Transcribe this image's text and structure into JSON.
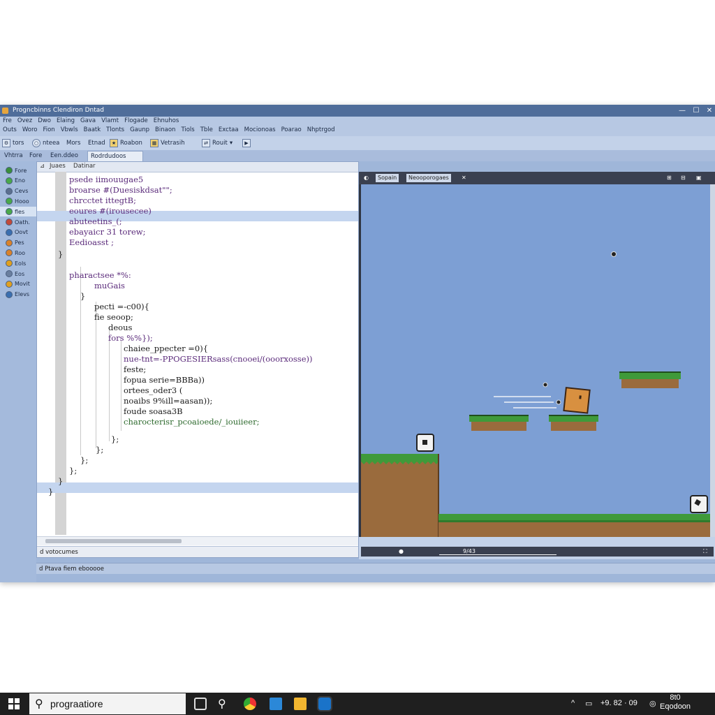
{
  "window": {
    "title": "Progncbinns Clendiron Dntad",
    "controls": [
      "—",
      "☐",
      "✕"
    ]
  },
  "menu": {
    "row1": [
      "Fre",
      "Ovez",
      "Dwo",
      "Elaing",
      "Gava",
      "Vlamt",
      "Flogade",
      "Ehnuhos"
    ],
    "row2": [
      "Outs",
      "Woro",
      "Fion",
      "Vbwls",
      "Baatk",
      "Tlonts",
      "Gaunp",
      "Binaon",
      "Tiols",
      "Tble",
      "Exctaa",
      "Mocionoas",
      "Poarao",
      "Nhptrgod"
    ]
  },
  "toolbar": {
    "items": [
      "tors",
      "nteea",
      "Mors",
      "Etnad",
      "Roabon",
      "Vetrasih",
      "Rouit"
    ],
    "dropdown_arrow": "▾"
  },
  "panel_tabs": [
    "Vhtrra",
    "Fore",
    "Een.ddeo",
    "Rodrdudoos"
  ],
  "sidebar": {
    "items": [
      {
        "label": "Fore",
        "color": "#3a8f3a"
      },
      {
        "label": "Eno",
        "color": "#4aa84a"
      },
      {
        "label": "Cevs",
        "color": "#5c6f8f"
      },
      {
        "label": "Hooo",
        "color": "#4aa84a"
      },
      {
        "label": "fles",
        "color": "#4aa84a"
      },
      {
        "label": "Oath.",
        "color": "#c24a3a"
      },
      {
        "label": "Oovt",
        "color": "#3a6fb0"
      },
      {
        "label": "Pes",
        "color": "#d9822b"
      },
      {
        "label": "Roo",
        "color": "#d9822b"
      },
      {
        "label": "Eols",
        "color": "#e0a020"
      },
      {
        "label": "Eos",
        "color": "#6a7f9f"
      },
      {
        "label": "Movit",
        "color": "#e0a020"
      },
      {
        "label": "Elevs",
        "color": "#3a6fb0"
      }
    ],
    "selected_index": 4
  },
  "editor": {
    "tabs": [
      "Juaes",
      "Datinar"
    ],
    "code_lines": [
      {
        "text": "psede iimouugae5",
        "color": "kw"
      },
      {
        "text": "broarse #(Duesiskdsat\"\";",
        "color": "kw"
      },
      {
        "text": "chrcctet ittegtB;",
        "color": "kw"
      },
      {
        "text": "eoures #(irousecee)",
        "color": "kw"
      },
      {
        "text": "abuteetins_(;",
        "color": "kw"
      },
      {
        "text": "ebayaicr 31 torew;",
        "color": "kw"
      },
      {
        "text": "Eedioasst ;",
        "color": "kw"
      },
      {
        "text": "}",
        "color": "kb"
      },
      {
        "text": "pharactsee *%:",
        "color": "kw"
      },
      {
        "text": "muGais",
        "color": "kw"
      },
      {
        "text": "}",
        "color": "kb"
      },
      {
        "text": "pecti =-c00){",
        "color": "kb"
      },
      {
        "text": "fie seoop;",
        "color": "kb"
      },
      {
        "text": "deous",
        "color": "kb"
      },
      {
        "text": "fors %%});",
        "color": "kw"
      },
      {
        "text": "chaiee_ppecter =0){",
        "color": "kb"
      },
      {
        "text": "nue-tnt=-PPOGESIERsass(cnooei/(ooorxosse))",
        "color": "kw"
      },
      {
        "text": "feste;",
        "color": "kb"
      },
      {
        "text": "fopua serie=BBBa))",
        "color": "kb"
      },
      {
        "text": "ortees_oder3 (",
        "color": "kb"
      },
      {
        "text": "noaibs 9%ill=aasan));",
        "color": "kb"
      },
      {
        "text": "foude soasa3B",
        "color": "kb"
      },
      {
        "text": "charocterisr_pcoaioede/_iouiieer;",
        "color": "kg"
      },
      {
        "text": "};",
        "color": "kb"
      },
      {
        "text": "};",
        "color": "kb"
      },
      {
        "text": "};",
        "color": "kb"
      },
      {
        "text": "};",
        "color": "kb"
      },
      {
        "text": "}",
        "color": "kb"
      },
      {
        "text": "}",
        "color": "kb"
      }
    ],
    "status": "d votocumes"
  },
  "game": {
    "tabs": [
      "Sopain",
      "Neooporogaes"
    ],
    "bottom_value": "9/43"
  },
  "statusbar": {
    "text": "d Ptava fiem ebooooe"
  },
  "taskbar": {
    "search_text": "prograatiore",
    "clock_time": "8t0",
    "clock_date": "Eqodoon",
    "tray_text": "+9. 82 · 09"
  },
  "colors": {
    "accent": "#4f6d9a",
    "scene_sky": "#7d9fd4",
    "grass": "#3f9a3a",
    "dirt": "#9a6b3d",
    "character": "#d89040"
  }
}
